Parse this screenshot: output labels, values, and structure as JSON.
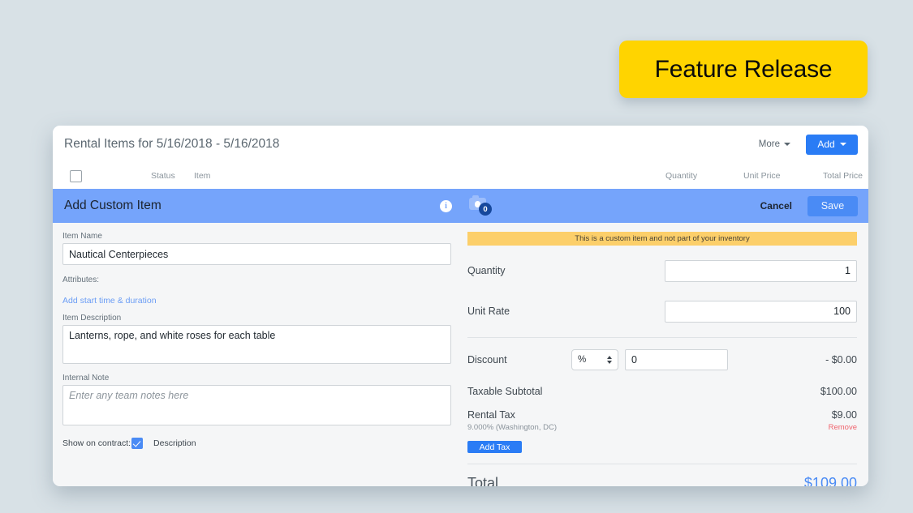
{
  "feature_badge": {
    "label": "Feature Release",
    "color": "#ffd400"
  },
  "card": {
    "title": "Rental Items for 5/16/2018 - 5/16/2018",
    "more_label": "More",
    "add_label": "Add",
    "table_headers": {
      "status": "Status",
      "item": "Item",
      "quantity": "Quantity",
      "unit_price": "Unit Price",
      "total_price": "Total Price"
    }
  },
  "action_bar": {
    "title": "Add Custom Item",
    "info_glyph": "i",
    "photo_count": "0",
    "cancel_label": "Cancel",
    "save_label": "Save",
    "bar_color": "#75a4fb"
  },
  "form": {
    "item_name_label": "Item Name",
    "item_name_value": "Nautical Centerpieces",
    "attributes_label": "Attributes:",
    "add_start_time_link": "Add start time & duration",
    "item_description_label": "Item Description",
    "item_description_value": "Lanterns, rope, and white roses for each table",
    "internal_note_label": "Internal Note",
    "internal_note_value": "",
    "internal_note_placeholder": "Enter any team notes here",
    "show_on_contract_label": "Show on contract:",
    "description_label": "Description"
  },
  "pricing": {
    "inventory_banner": "This is a custom item and not part of your inventory",
    "quantity_label": "Quantity",
    "quantity_value": "1",
    "unit_rate_label": "Unit Rate",
    "unit_rate_value": "100",
    "discount_label": "Discount",
    "discount_type": "%",
    "discount_value": "0",
    "discount_amount": "- $0.00",
    "taxable_subtotal_label": "Taxable Subtotal",
    "taxable_subtotal_amount": "$100.00",
    "tax_name": "Rental Tax",
    "tax_detail": "9.000% (Washington, DC)",
    "tax_amount": "$9.00",
    "tax_remove_label": "Remove",
    "add_tax_label": "Add Tax",
    "total_label": "Total",
    "total_amount": "$109.00",
    "banner_color": "#fccf6a",
    "total_color": "#4a8bf5"
  }
}
